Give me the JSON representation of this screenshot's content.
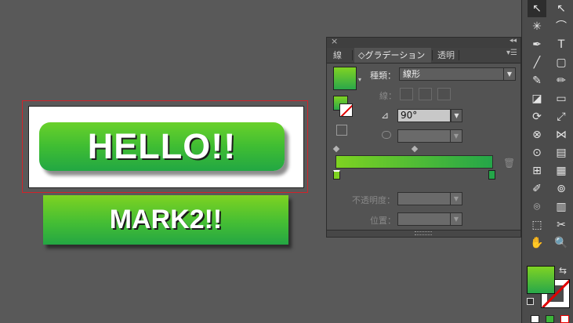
{
  "canvas": {
    "button_hello_text": "HELLO!!",
    "button_mark2_text": "MARK2!!"
  },
  "panel": {
    "close_glyph": "×",
    "collapse_glyph": "◂◂",
    "menu_glyph": "▾☰",
    "tabs": [
      {
        "label": "線"
      },
      {
        "label": "◇グラデーション"
      },
      {
        "label": "透明"
      }
    ],
    "type_label": "種類：",
    "type_value": "線形",
    "stroke_label": "線：",
    "angle_value": "90°",
    "opacity_label": "不透明度：",
    "position_label": "位置：",
    "gradient_colors": {
      "start": "#7ed321",
      "end": "#24a649"
    }
  },
  "icons": {
    "angle": "⊿",
    "trash": "🗑",
    "caret": "▾",
    "arrow": "▼"
  },
  "toolbox": {
    "tools": [
      "↖",
      "↖",
      "✳",
      "⌒",
      "✒",
      "T",
      "╱",
      "▢",
      "✎",
      "✏",
      "◪",
      "▭",
      "⟳",
      "⤢",
      "⊗",
      "⋈",
      "⊙",
      "▤",
      "⊞",
      "▦",
      "✐",
      "⊚",
      "⌾",
      "▥",
      "⬚",
      "✂",
      "✋",
      "🔍"
    ],
    "swap_glyph": "⇆"
  }
}
